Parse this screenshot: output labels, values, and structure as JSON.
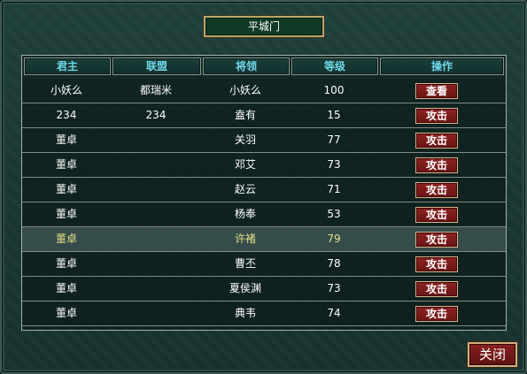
{
  "dialog": {
    "title": "平城门",
    "close_label": "关闭"
  },
  "table": {
    "headers": [
      "君主",
      "联盟",
      "将领",
      "等级",
      "操作"
    ],
    "rows": [
      {
        "lord": "小妖么",
        "alliance": "都瑞米",
        "general": "小妖么",
        "level": "100",
        "action": "查看"
      },
      {
        "lord": "234",
        "alliance": "234",
        "general": "盍有",
        "level": "15",
        "action": "攻击"
      },
      {
        "lord": "董卓",
        "alliance": "",
        "general": "关羽",
        "level": "77",
        "action": "攻击"
      },
      {
        "lord": "董卓",
        "alliance": "",
        "general": "邓艾",
        "level": "73",
        "action": "攻击"
      },
      {
        "lord": "董卓",
        "alliance": "",
        "general": "赵云",
        "level": "71",
        "action": "攻击"
      },
      {
        "lord": "董卓",
        "alliance": "",
        "general": "杨奉",
        "level": "53",
        "action": "攻击"
      },
      {
        "lord": "董卓",
        "alliance": "",
        "general": "许褚",
        "level": "79",
        "action": "攻击",
        "highlighted": true
      },
      {
        "lord": "董卓",
        "alliance": "",
        "general": "曹丕",
        "level": "78",
        "action": "攻击"
      },
      {
        "lord": "董卓",
        "alliance": "",
        "general": "夏侯渊",
        "level": "73",
        "action": "攻击"
      },
      {
        "lord": "董卓",
        "alliance": "",
        "general": "典韦",
        "level": "74",
        "action": "攻击"
      }
    ]
  },
  "colors": {
    "header_text": "#6fd7e8",
    "highlight_text": "#e6e08a",
    "button_red": "#7a1a1a",
    "title_green": "#0f3a25"
  }
}
